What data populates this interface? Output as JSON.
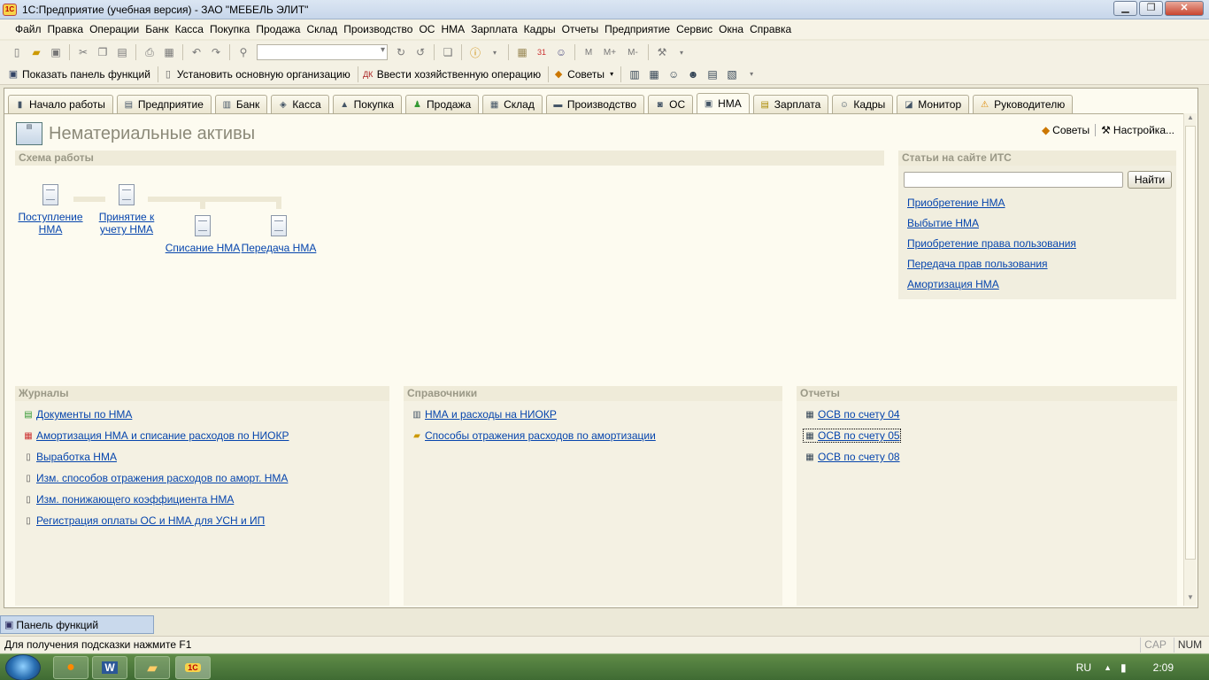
{
  "window": {
    "title": "1С:Предприятие (учебная версия) - ЗАО \"МЕБЕЛЬ ЭЛИТ\"",
    "app_icon": "1С"
  },
  "menu": [
    "Файл",
    "Правка",
    "Операции",
    "Банк",
    "Касса",
    "Покупка",
    "Продажа",
    "Склад",
    "Производство",
    "ОС",
    "НМА",
    "Зарплата",
    "Кадры",
    "Отчеты",
    "Предприятие",
    "Сервис",
    "Окна",
    "Справка"
  ],
  "toolbar2": {
    "show_panel": "Показать панель функций",
    "set_org": "Установить основную организацию",
    "enter_op": "Ввести хозяйственную операцию",
    "tips": "Советы"
  },
  "tabs": [
    "Начало работы",
    "Предприятие",
    "Банк",
    "Касса",
    "Покупка",
    "Продажа",
    "Склад",
    "Производство",
    "ОС",
    "НМА",
    "Зарплата",
    "Кадры",
    "Монитор",
    "Руководителю"
  ],
  "active_tab": "НМА",
  "page": {
    "title": "Нематериальные активы",
    "tips": "Советы",
    "settings": "Настройка..."
  },
  "schema": {
    "header": "Схема работы",
    "nodes": [
      {
        "line1": "Поступление",
        "line2": "НМА"
      },
      {
        "line1": "Принятие к",
        "line2": "учету НМА"
      },
      {
        "line1": "Списание НМА",
        "line2": ""
      },
      {
        "line1": "Передача НМА",
        "line2": ""
      }
    ]
  },
  "its": {
    "header": "Статьи на сайте ИТС",
    "search_value": "",
    "find_button": "Найти",
    "links": [
      "Приобретение НМА",
      "Выбытие НМА",
      "Приобретение права пользования",
      "Передача прав пользования",
      "Амортизация НМА"
    ]
  },
  "journals": {
    "header": "Журналы",
    "items": [
      "Документы по НМА",
      "Амортизация НМА и списание расходов по НИОКР",
      "Выработка НМА",
      "Изм. способов отражения расходов по аморт. НМА",
      "Изм. понижающего коэффициента НМА",
      "Регистрация оплаты ОС и НМА для УСН и ИП"
    ]
  },
  "references": {
    "header": "Справочники",
    "items": [
      "НМА и расходы на НИОКР",
      "Способы отражения расходов по амортизации"
    ]
  },
  "reports": {
    "header": "Отчеты",
    "items": [
      "ОСВ по счету 04",
      "ОСВ по счету 05",
      "ОСВ по счету 08"
    ]
  },
  "funcbar": "Панель функций",
  "status": {
    "hint": "Для получения подсказки нажмите F1",
    "cap": "CAP",
    "num": "NUM"
  },
  "taskbar": {
    "lang": "RU",
    "time": "2:09",
    "word_icon": "W",
    "onec_icon": "1С"
  }
}
